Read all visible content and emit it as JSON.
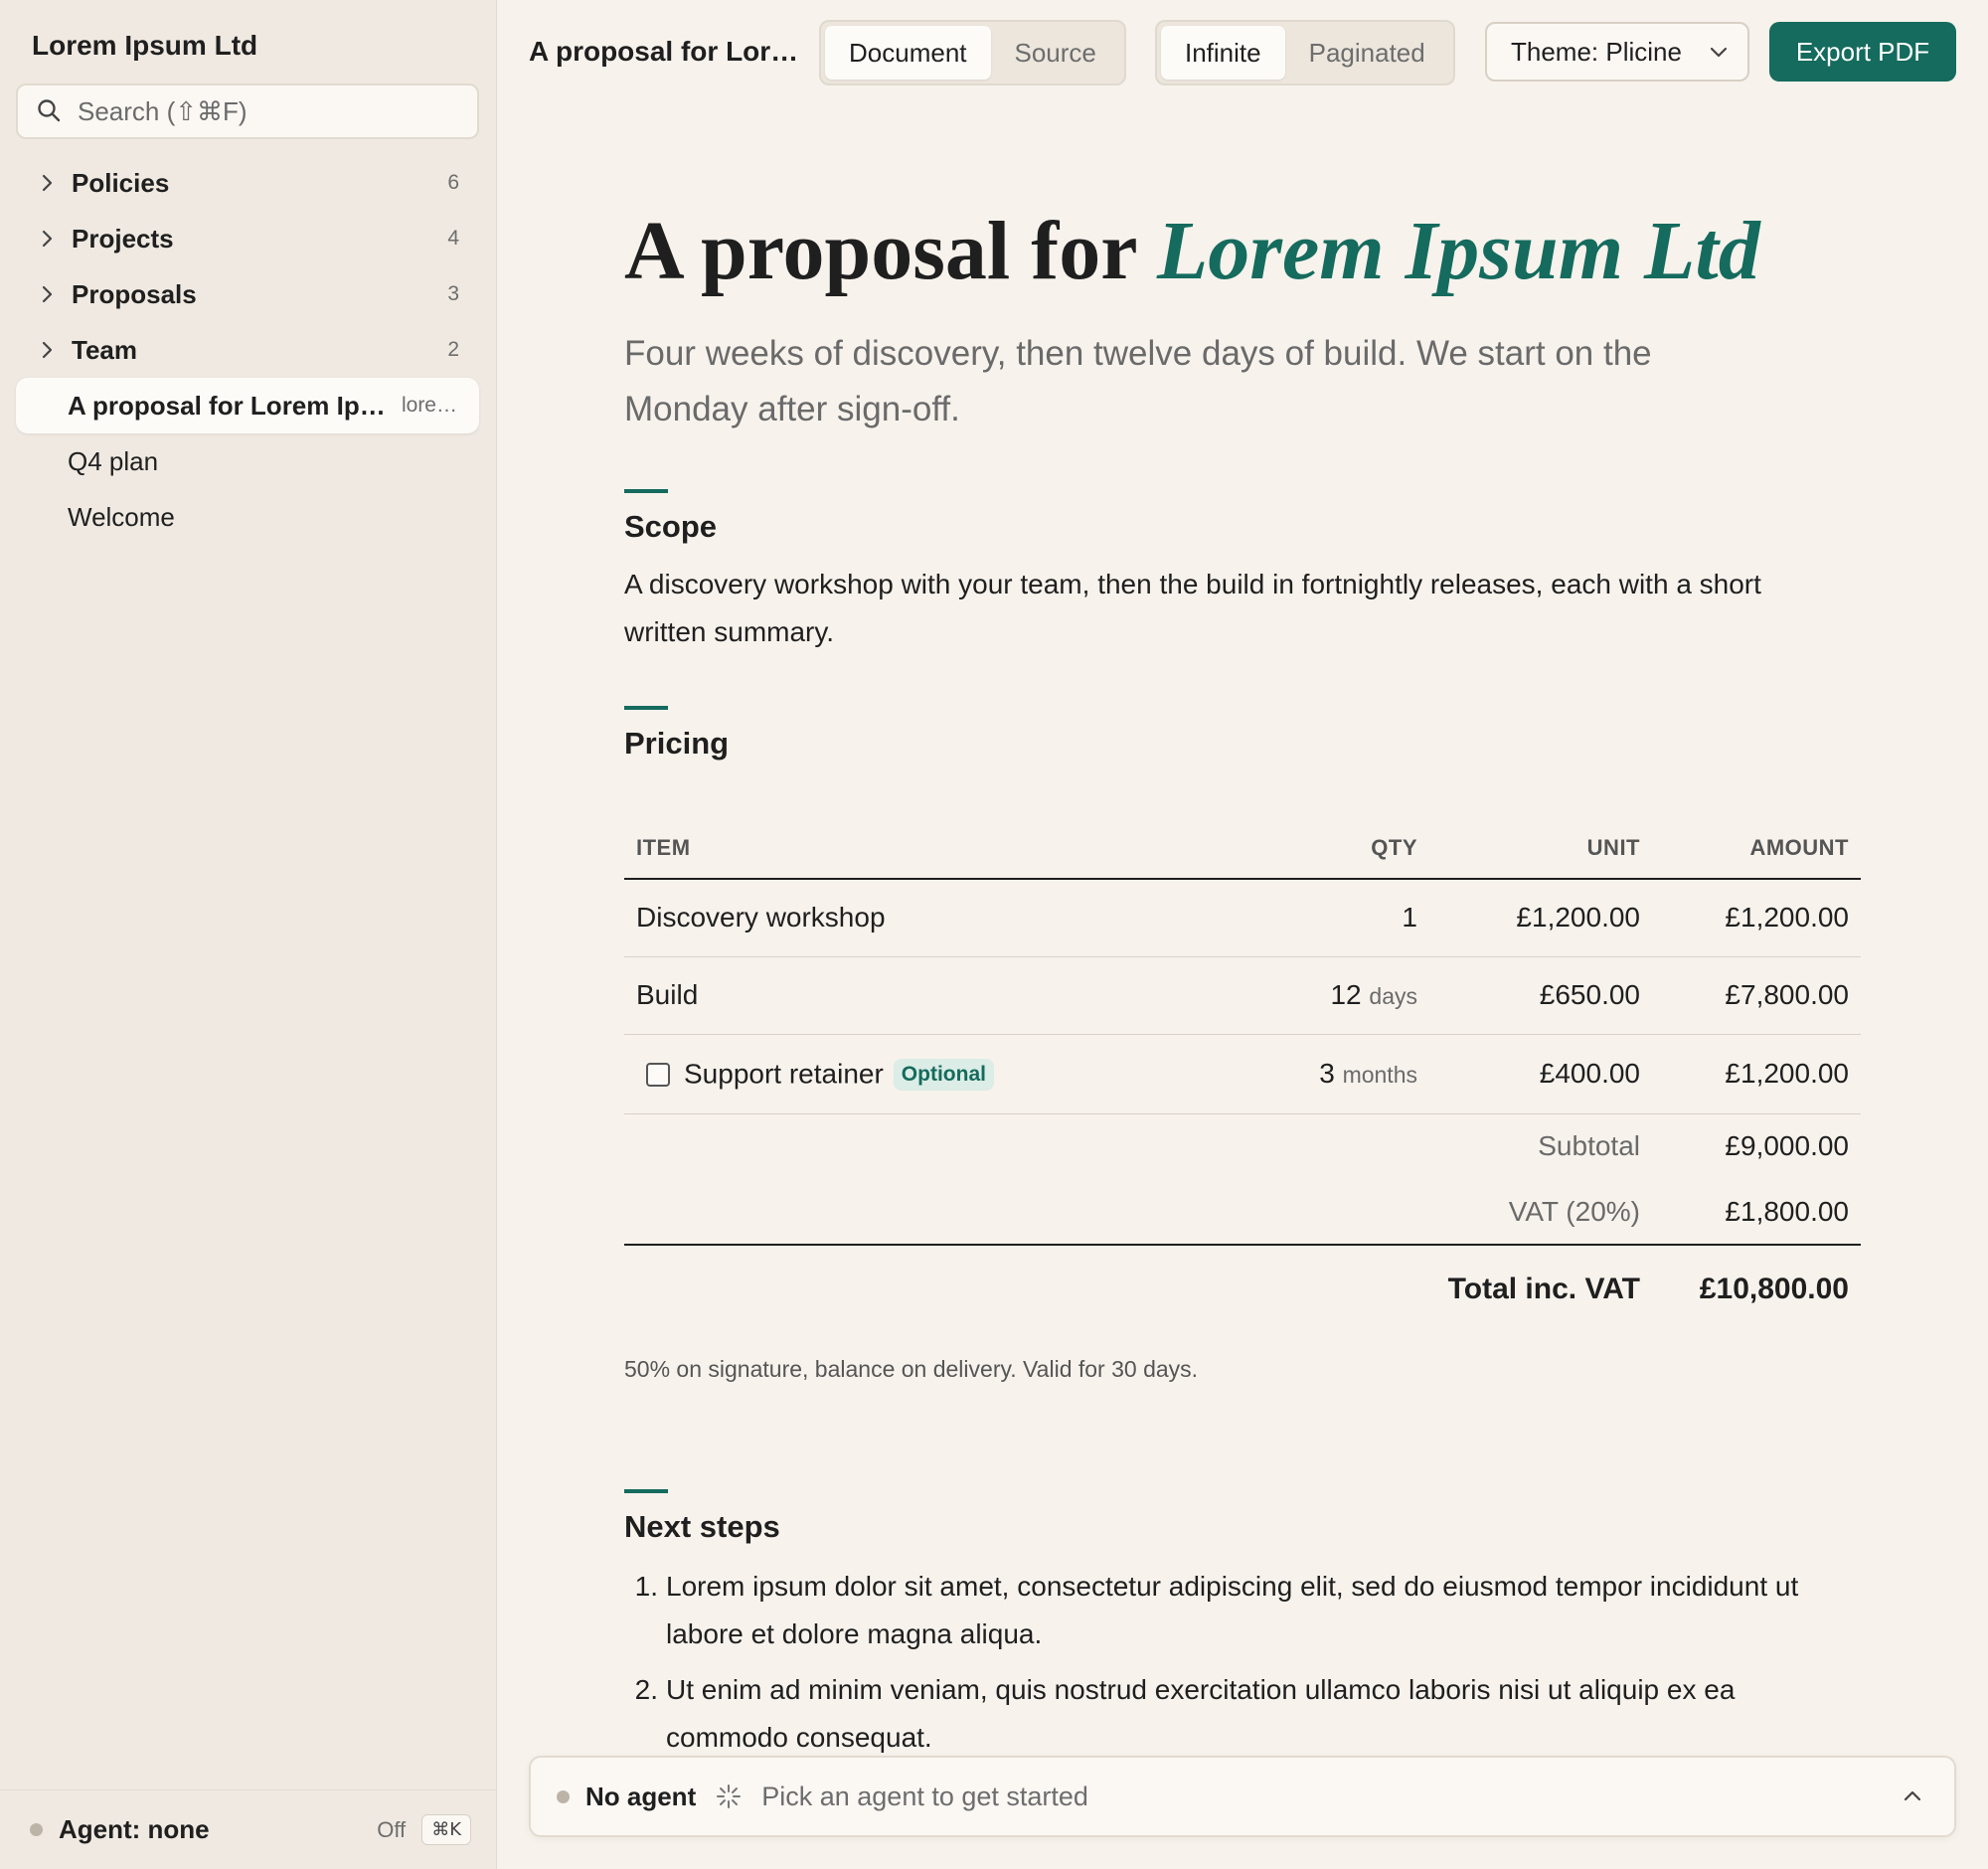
{
  "sidebar": {
    "workspace": "Lorem Ipsum Ltd",
    "search": {
      "placeholder": "Search (⇧⌘F)"
    },
    "groups": [
      {
        "label": "Policies",
        "count": "6"
      },
      {
        "label": "Projects",
        "count": "4"
      },
      {
        "label": "Proposals",
        "count": "3"
      },
      {
        "label": "Team",
        "count": "2"
      }
    ],
    "docs": [
      {
        "label": "A proposal for Lorem Ipsum Ltd",
        "slug": "lore…"
      },
      {
        "label": "Q4 plan"
      },
      {
        "label": "Welcome"
      }
    ],
    "footer": {
      "agent": "Agent: none",
      "status": "Off",
      "shortcut": "⌘K"
    }
  },
  "topbar": {
    "title": "A proposal for Lor…",
    "view_modes": [
      "Document",
      "Source"
    ],
    "view_selected": "Document",
    "layout_modes": [
      "Infinite",
      "Paginated"
    ],
    "layout_selected": "Infinite",
    "theme": "Theme: Plicine",
    "export": "Export PDF"
  },
  "document": {
    "title_plain": "A proposal for",
    "title_accent": "Lorem Ipsum Ltd",
    "lead": "Four weeks of discovery, then twelve days of build. We start on the Monday after sign-off.",
    "scope": {
      "heading": "Scope",
      "body": "A discovery workshop with your team, then the build in fortnightly releases, each with a short written summary."
    },
    "pricing": {
      "heading": "Pricing",
      "columns": [
        "ITEM",
        "QTY",
        "UNIT",
        "AMOUNT"
      ],
      "rows": [
        {
          "item": "Discovery workshop",
          "qty": "1",
          "qty_unit": "",
          "unit": "£1,200.00",
          "amount": "£1,200.00"
        },
        {
          "item": "Build",
          "qty": "12",
          "qty_unit": "days",
          "unit": "£650.00",
          "amount": "£7,800.00"
        },
        {
          "item": "Support retainer",
          "badge": "Optional",
          "checked": false,
          "qty": "3",
          "qty_unit": "months",
          "unit": "£400.00",
          "amount": "£1,200.00"
        }
      ],
      "subtotal_label": "Subtotal",
      "subtotal": "£9,000.00",
      "vat_label": "VAT (20%)",
      "vat": "£1,800.00",
      "total_label": "Total inc. VAT",
      "total": "£10,800.00",
      "note": "50% on signature, balance on delivery. Valid for 30 days."
    },
    "next_steps": {
      "heading": "Next steps",
      "items": [
        "Lorem ipsum dolor sit amet, consectetur adipiscing elit, sed do eiusmod tempor incididunt ut labore et dolore magna aliqua.",
        "Ut enim ad minim veniam, quis nostrud exercitation ullamco laboris nisi ut aliquip ex ea commodo consequat."
      ]
    }
  },
  "agent_bar": {
    "name": "No agent",
    "hint": "Pick an agent to get started"
  },
  "colors": {
    "accent": "#156b5d",
    "background": "#f7f2ec",
    "sidebar": "#efe9e1"
  }
}
